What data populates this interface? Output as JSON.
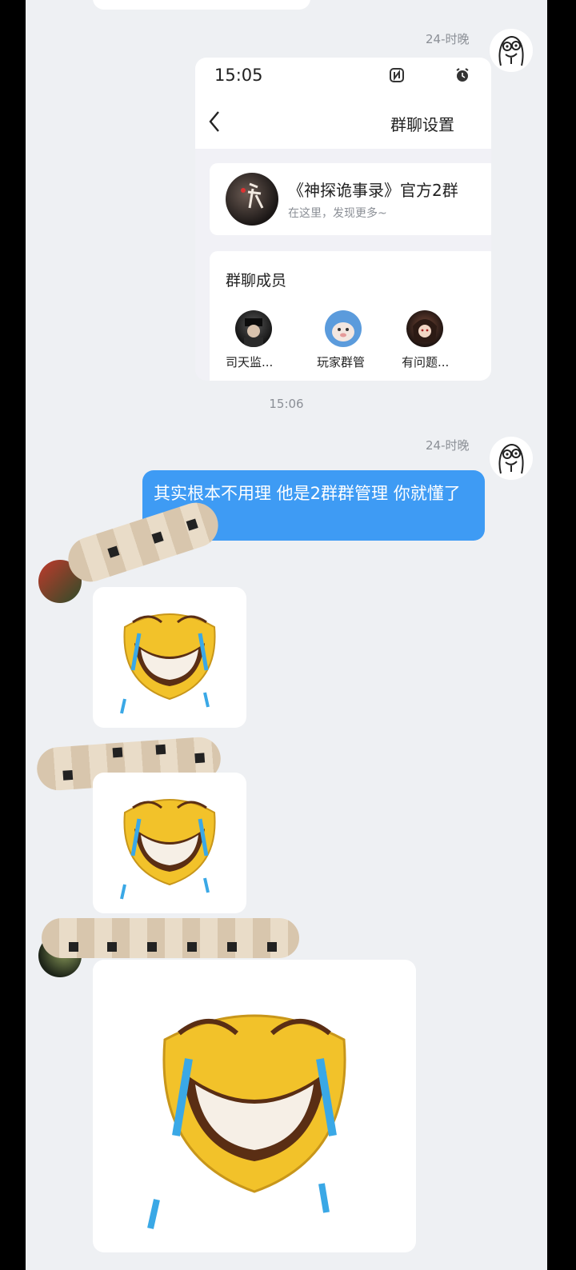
{
  "messages": {
    "timestamp_1": "24-时晚",
    "timestamp_2": "24-时晚",
    "center_time": "15:06",
    "text_message": "其实根本不用理 他是2群群管理 你就懂了"
  },
  "screenshot": {
    "status_time": "15:05",
    "nav_title": "群聊设置",
    "group_name": "《神探诡事录》官方2群",
    "group_subtitle": "在这里，发现更多~",
    "members_title": "群聊成员",
    "members": [
      {
        "label": "司天监..."
      },
      {
        "label": "玩家群管"
      },
      {
        "label": "有问题..."
      }
    ]
  },
  "colors": {
    "chat_bg": "#eef0f3",
    "bubble_blue": "#3e9bf4",
    "frame": "#000000"
  },
  "icons": [
    "back-chevron-icon",
    "nfc-icon",
    "alarm-icon",
    "laughing-crying-emoji"
  ]
}
